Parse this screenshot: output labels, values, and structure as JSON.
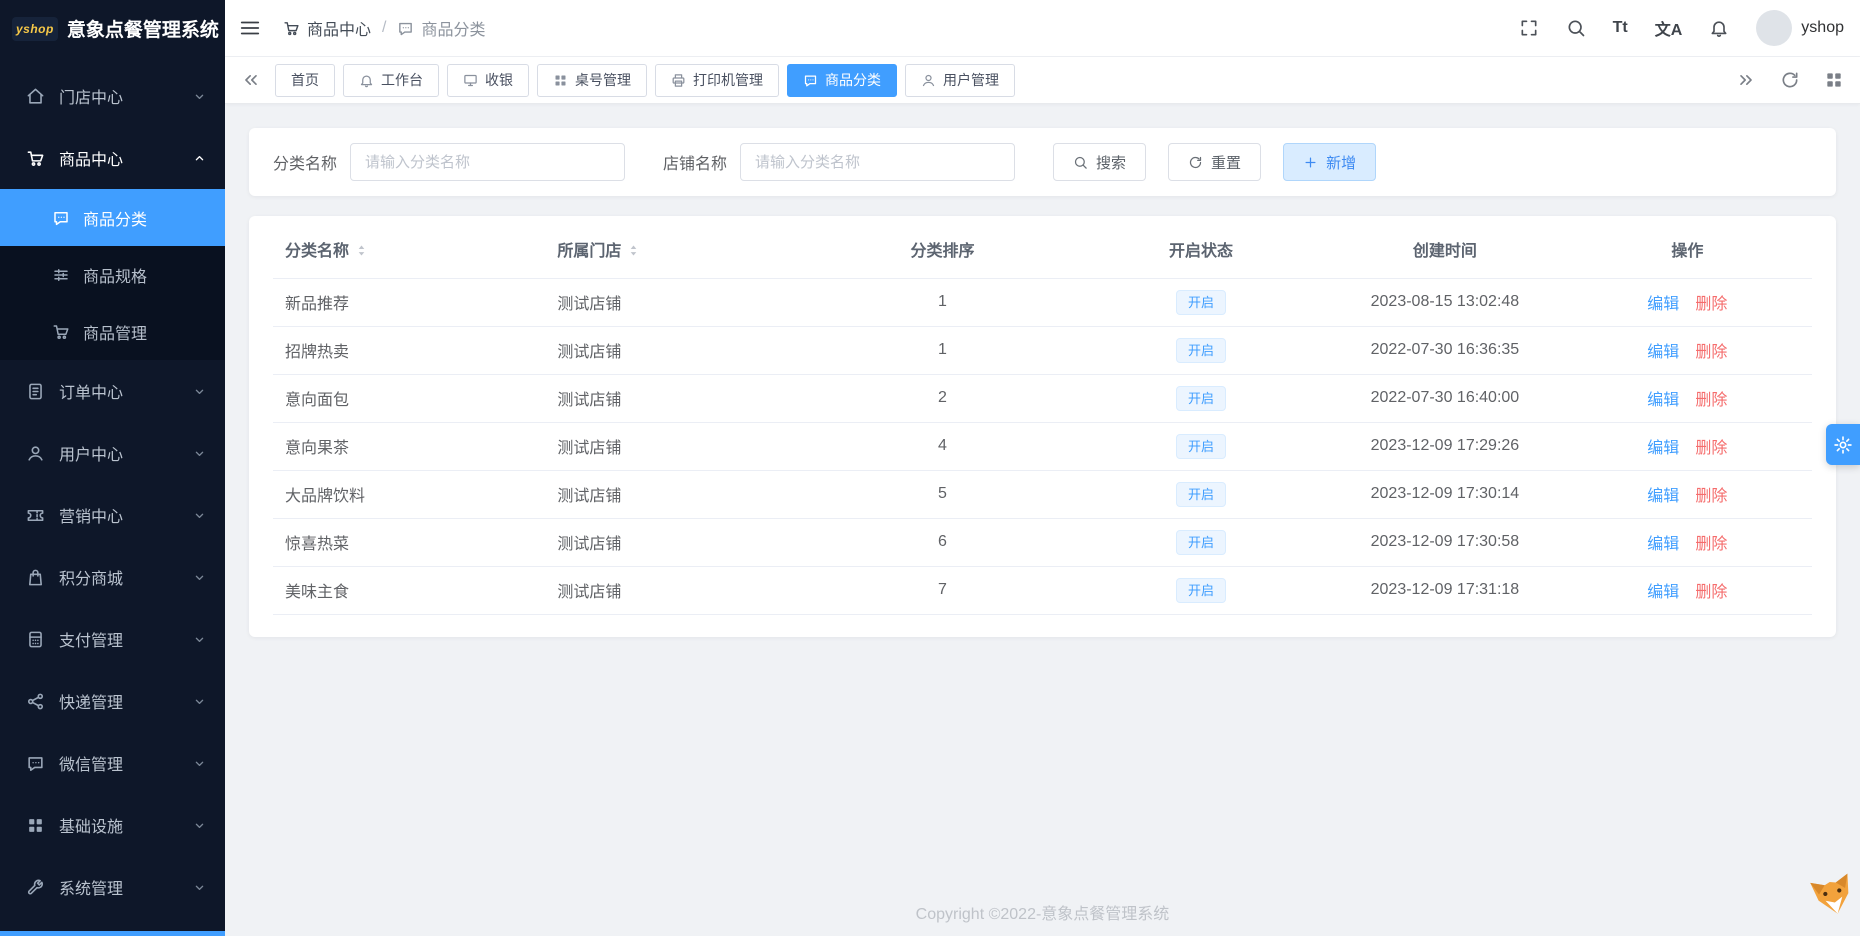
{
  "app": {
    "logo_text": "yshop",
    "title": "意象点餐管理系统"
  },
  "header": {
    "user_name": "yshop",
    "font_size_glyph": "Tt",
    "translate_glyph": "文A"
  },
  "breadcrumb": {
    "separator": "/",
    "items": [
      {
        "label": "商品中心"
      },
      {
        "label": "商品分类"
      }
    ]
  },
  "tabs": [
    {
      "label": "首页"
    },
    {
      "label": "工作台"
    },
    {
      "label": "收银"
    },
    {
      "label": "桌号管理"
    },
    {
      "label": "打印机管理"
    },
    {
      "label": "商品分类",
      "active": true
    },
    {
      "label": "用户管理"
    }
  ],
  "sidebar": {
    "items": [
      {
        "label": "门店中心"
      },
      {
        "label": "商品中心",
        "expanded": true,
        "children": [
          {
            "label": "商品分类",
            "active": true
          },
          {
            "label": "商品规格"
          },
          {
            "label": "商品管理"
          }
        ]
      },
      {
        "label": "订单中心"
      },
      {
        "label": "用户中心"
      },
      {
        "label": "营销中心"
      },
      {
        "label": "积分商城"
      },
      {
        "label": "支付管理"
      },
      {
        "label": "快递管理"
      },
      {
        "label": "微信管理"
      },
      {
        "label": "基础设施"
      },
      {
        "label": "系统管理"
      }
    ]
  },
  "filters": {
    "category_label": "分类名称",
    "category_placeholder": "请输入分类名称",
    "shop_label": "店铺名称",
    "shop_placeholder": "请输入分类名称",
    "search": "搜索",
    "reset": "重置",
    "add": "新增"
  },
  "table": {
    "columns": [
      "分类名称",
      "所属门店",
      "分类排序",
      "开启状态",
      "创建时间",
      "操作"
    ],
    "actions": {
      "edit": "编辑",
      "delete": "删除"
    },
    "rows": [
      {
        "name": "新品推荐",
        "store": "测试店铺",
        "sort": "1",
        "status": "开启",
        "created": "2023-08-15 13:02:48"
      },
      {
        "name": "招牌热卖",
        "store": "测试店铺",
        "sort": "1",
        "status": "开启",
        "created": "2022-07-30 16:36:35"
      },
      {
        "name": "意向面包",
        "store": "测试店铺",
        "sort": "2",
        "status": "开启",
        "created": "2022-07-30 16:40:00"
      },
      {
        "name": "意向果茶",
        "store": "测试店铺",
        "sort": "4",
        "status": "开启",
        "created": "2023-12-09 17:29:26"
      },
      {
        "name": "大品牌饮料",
        "store": "测试店铺",
        "sort": "5",
        "status": "开启",
        "created": "2023-12-09 17:30:14"
      },
      {
        "name": "惊喜热菜",
        "store": "测试店铺",
        "sort": "6",
        "status": "开启",
        "created": "2023-12-09 17:30:58"
      },
      {
        "name": "美味主食",
        "store": "测试店铺",
        "sort": "7",
        "status": "开启",
        "created": "2023-12-09 17:31:18"
      }
    ]
  },
  "footer": {
    "copyright": "Copyright ©2022-意象点餐管理系统"
  },
  "colors": {
    "primary": "#409eff",
    "danger": "#f56c6c",
    "sidebar_bg": "#0e1729"
  }
}
